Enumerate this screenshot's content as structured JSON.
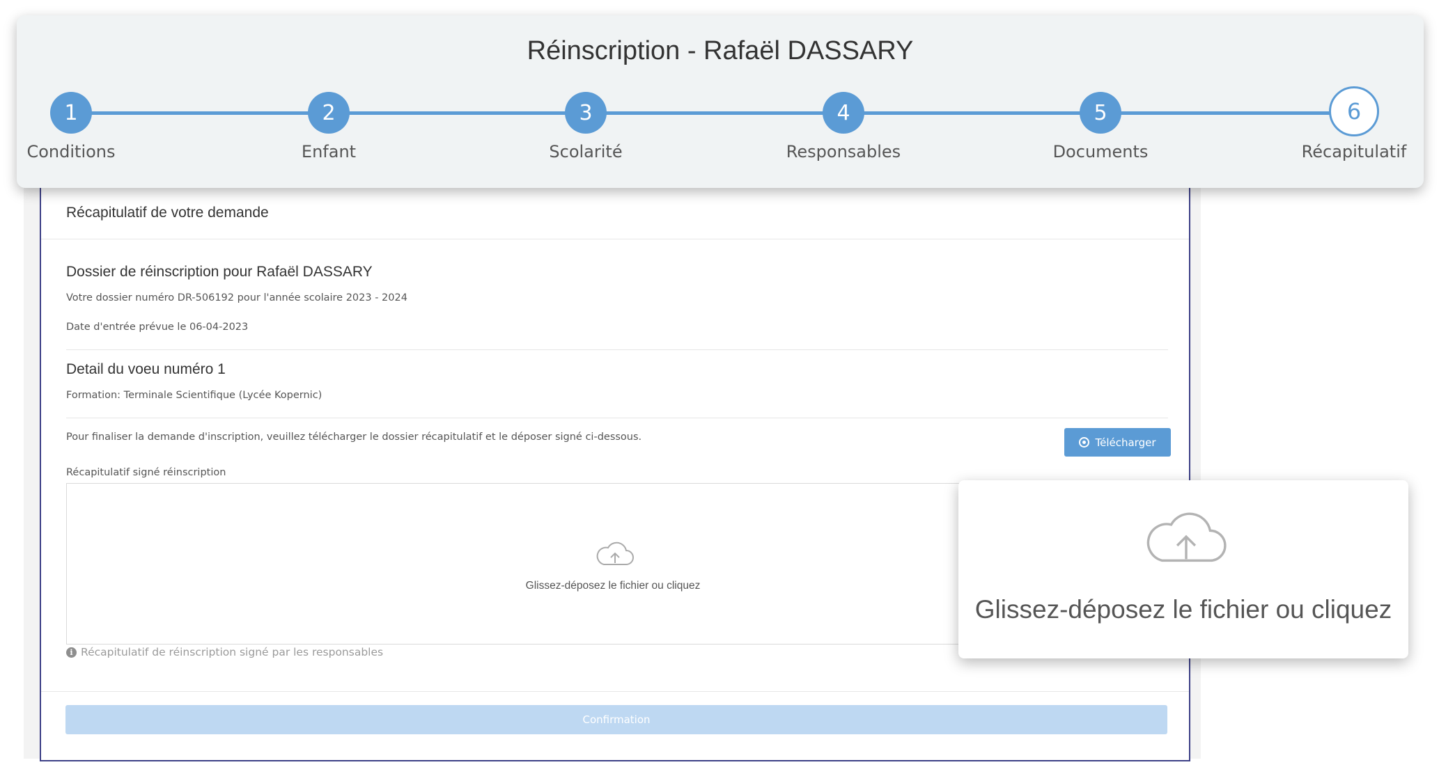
{
  "header": {
    "title": "Réinscription - Rafaël DASSARY"
  },
  "steps": [
    {
      "number": "1",
      "label": "Conditions"
    },
    {
      "number": "2",
      "label": "Enfant"
    },
    {
      "number": "3",
      "label": "Scolarité"
    },
    {
      "number": "4",
      "label": "Responsables"
    },
    {
      "number": "5",
      "label": "Documents"
    },
    {
      "number": "6",
      "label": "Récapitulatif"
    }
  ],
  "recap": {
    "panel_title": "Récapitulatif de votre demande",
    "dossier_title": "Dossier de réinscription pour Rafaël DASSARY",
    "dossier_number": "Votre dossier numéro DR-506192 pour l'année scolaire 2023 - 2024",
    "entry_date": "Date d'entrée prévue le 06-04-2023",
    "voeu_title": "Detail du voeu numéro 1",
    "formation": "Formation: Terminale Scientifique (Lycée Kopernic)",
    "finalize_text": "Pour finaliser la demande d'inscription, veuillez télécharger le dossier récapitulatif et le déposer signé ci-dessous.",
    "download_label": "Télécharger",
    "upload_label": "Récapitulatif signé réinscription",
    "dropzone_text": "Glissez-déposez le fichier ou cliquez",
    "help_text": "Récapitulatif de réinscription signé par les responsables",
    "confirm_label": "Confirmation"
  },
  "callout": {
    "text": "Glissez-déposez le fichier ou cliquez"
  },
  "colors": {
    "accent": "#5b9bd5",
    "confirm_disabled": "#bed8f2",
    "panel_border": "#3c3f86"
  },
  "icons": {
    "upload": "cloud-upload-icon",
    "download": "circle-download-icon",
    "info": "info-circle-icon"
  }
}
